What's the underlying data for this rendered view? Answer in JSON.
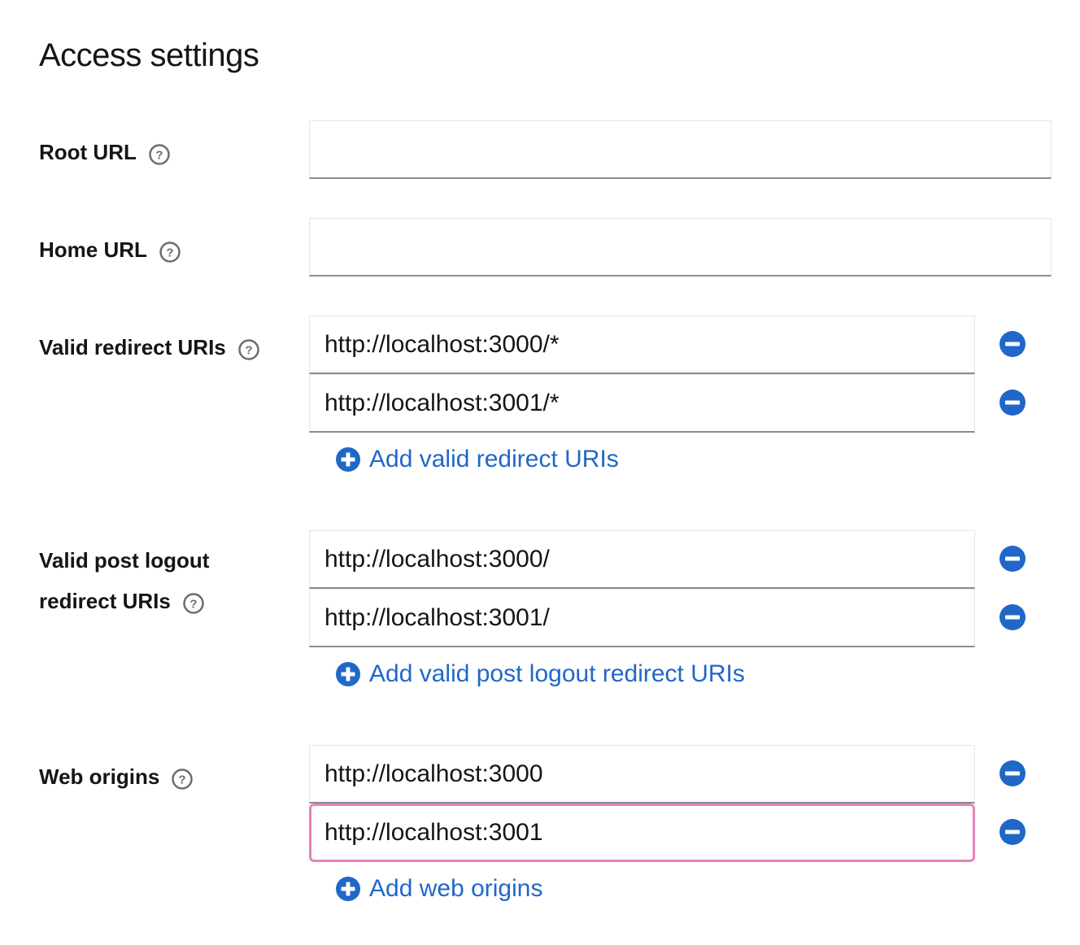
{
  "title": "Access settings",
  "fields": {
    "root_url": {
      "label": "Root URL",
      "value": ""
    },
    "home_url": {
      "label": "Home URL",
      "value": ""
    },
    "valid_redirect_uris": {
      "label": "Valid redirect URIs",
      "values": [
        "http://localhost:3000/*",
        "http://localhost:3001/*"
      ],
      "add_label": "Add valid redirect URIs"
    },
    "valid_post_logout_redirect_uris": {
      "label_line1": "Valid post logout",
      "label_line2": "redirect URIs",
      "values": [
        "http://localhost:3000/",
        "http://localhost:3001/"
      ],
      "add_label": "Add valid post logout redirect URIs"
    },
    "web_origins": {
      "label": "Web origins",
      "values": [
        "http://localhost:3000",
        "http://localhost:3001"
      ],
      "add_label": "Add web origins"
    }
  },
  "icons": {
    "help": "help-circle-icon",
    "remove": "minus-circle-icon",
    "add": "plus-circle-icon"
  },
  "colors": {
    "link": "#2167c8",
    "remove_icon": "#2167c8",
    "focus_border": "#e684b8"
  }
}
